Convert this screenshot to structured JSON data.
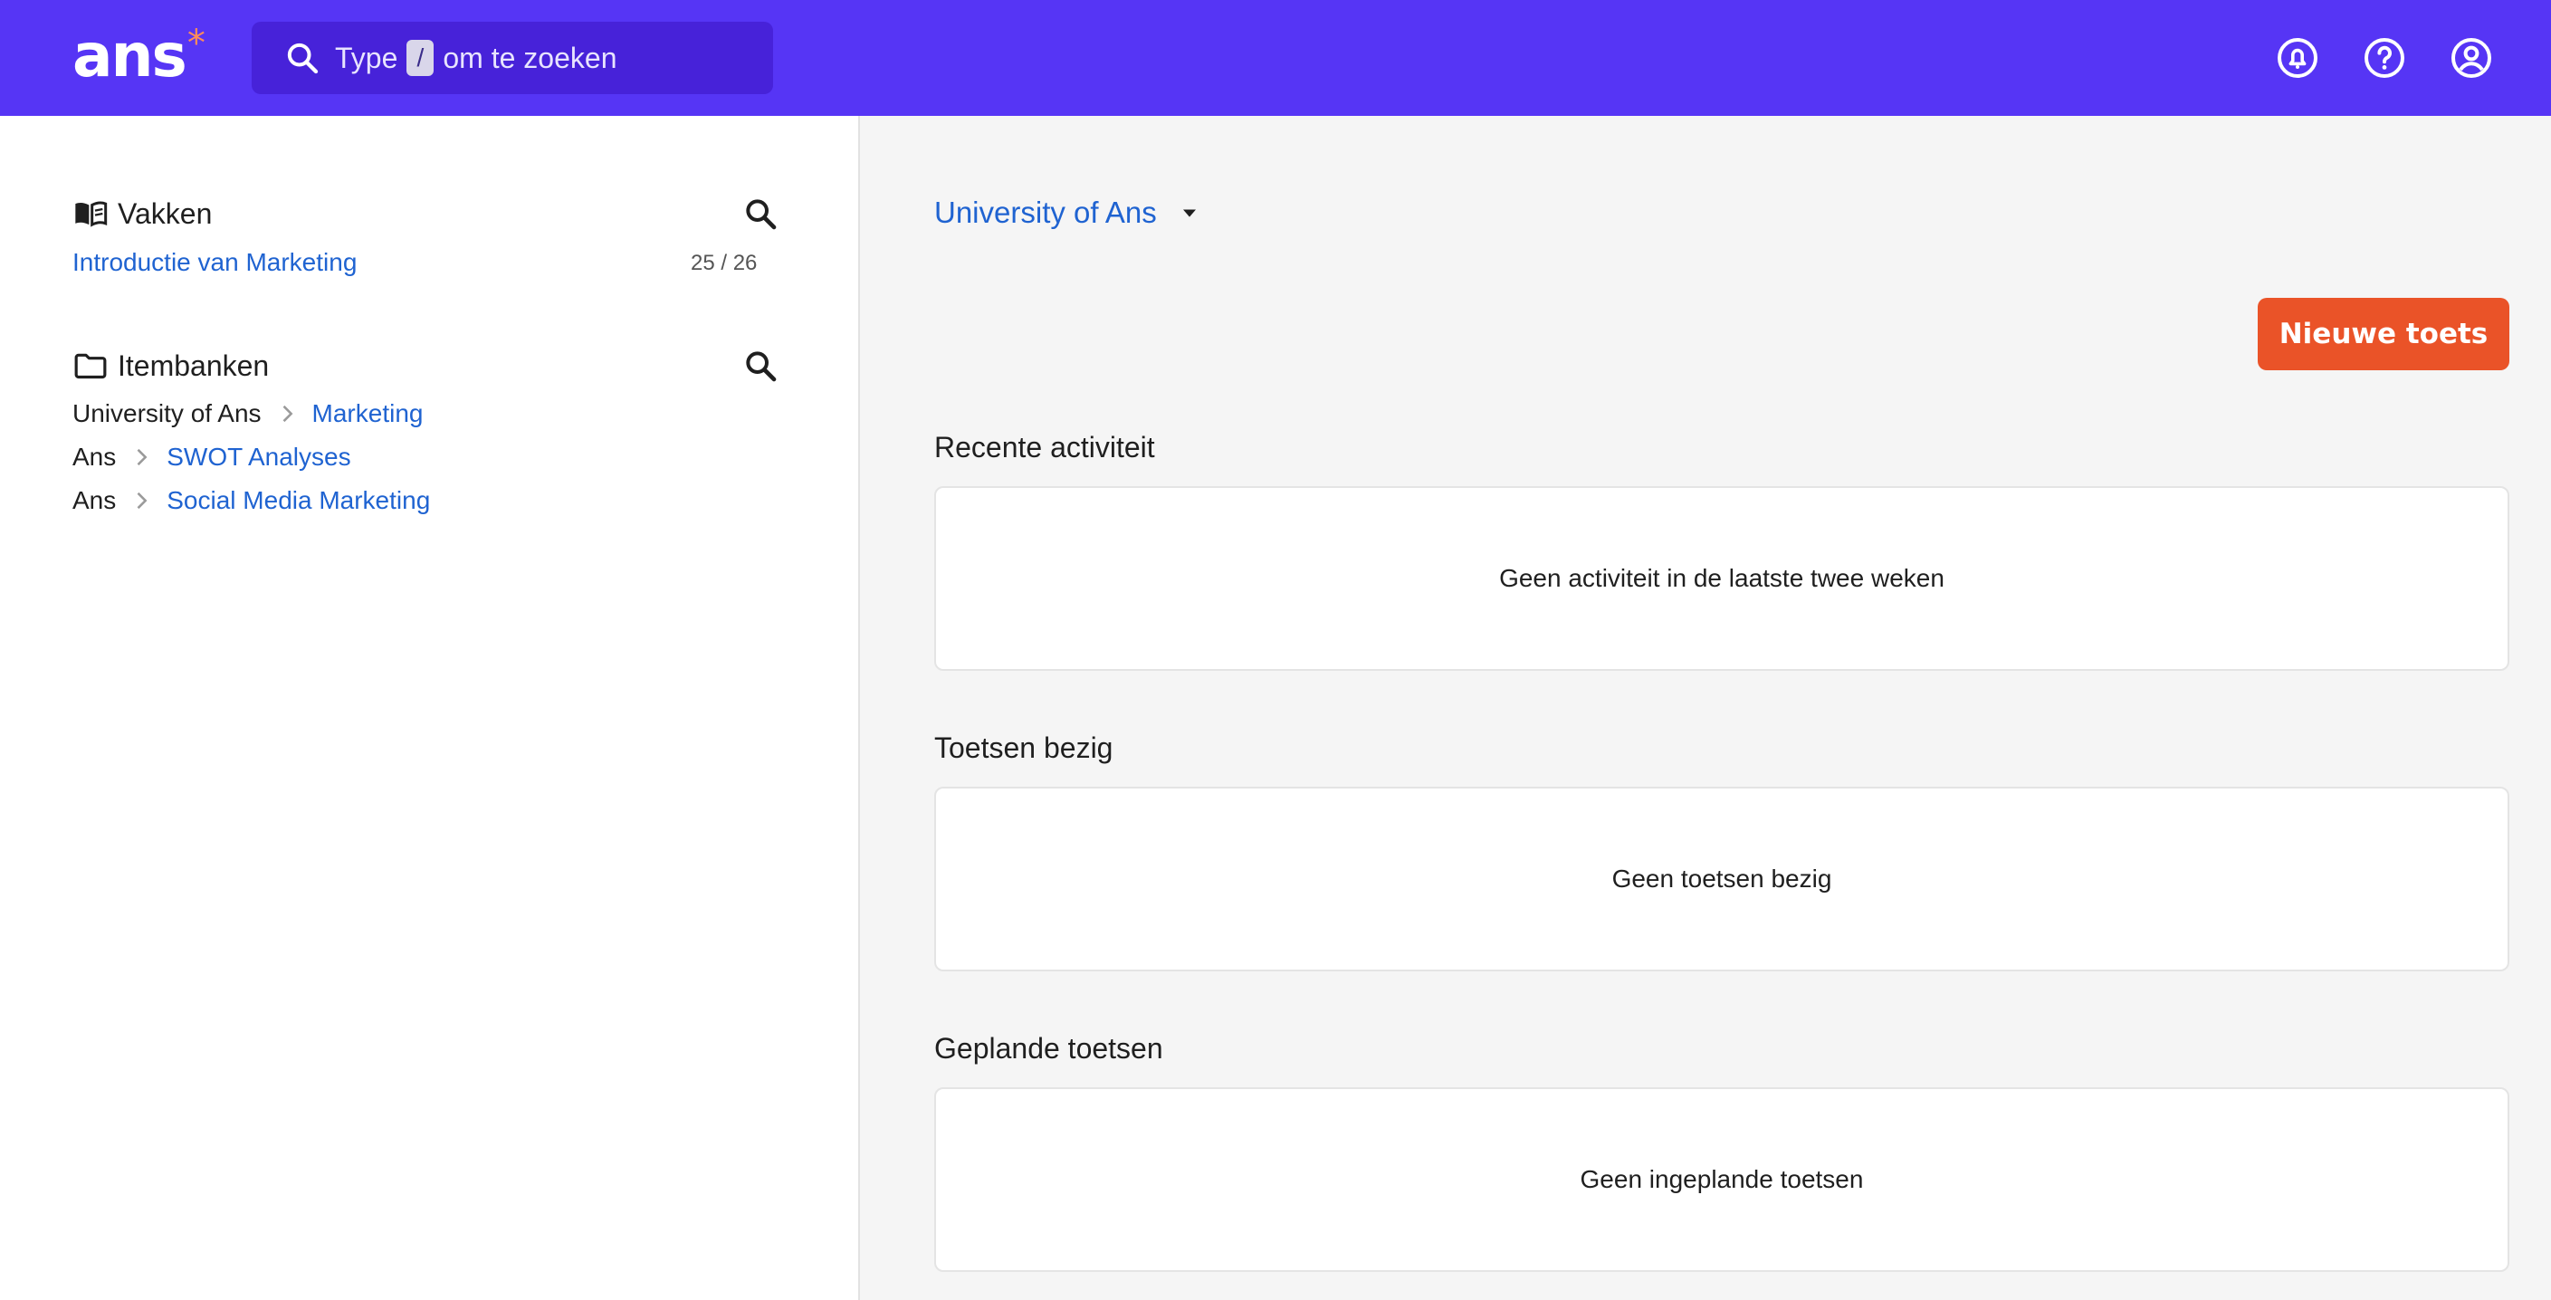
{
  "brand": {
    "name": "ans",
    "star": "*",
    "accent": "#5635f5"
  },
  "search": {
    "prefix": "Type",
    "key": "/",
    "suffix": "om te zoeken"
  },
  "header_icons": [
    "notifications-icon",
    "help-icon",
    "account-icon"
  ],
  "sidebar": {
    "courses": {
      "title": "Vakken",
      "items": [
        {
          "label": "Introductie van Marketing",
          "count": "25 / 26"
        }
      ]
    },
    "itembanks": {
      "title": "Itembanken",
      "items": [
        {
          "parent": "University of Ans",
          "label": "Marketing"
        },
        {
          "parent": "Ans",
          "label": "SWOT Analyses"
        },
        {
          "parent": "Ans",
          "label": "Social Media Marketing"
        }
      ]
    }
  },
  "main": {
    "organization": "University of Ans",
    "new_test_button": "Nieuwe toets",
    "sections": [
      {
        "title": "Recente activiteit",
        "empty": "Geen activiteit in de laatste twee weken"
      },
      {
        "title": "Toetsen bezig",
        "empty": "Geen toetsen bezig"
      },
      {
        "title": "Geplande toetsen",
        "empty": "Geen ingeplande toetsen"
      }
    ]
  },
  "colors": {
    "button": "#ea5328",
    "link": "#1f63d1"
  }
}
